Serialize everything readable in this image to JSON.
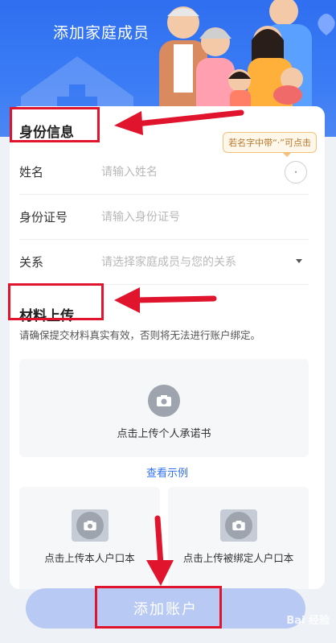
{
  "header": {
    "title": "添加家庭成员"
  },
  "identity": {
    "section_title": "身份信息",
    "tip": "若名字中带“·”可点击",
    "dot_button": "·",
    "fields": [
      {
        "label": "姓名",
        "placeholder": "请输入姓名"
      },
      {
        "label": "身份证号",
        "placeholder": "请输入身份证号"
      },
      {
        "label": "关系",
        "placeholder": "请选择家庭成员与您的关系"
      }
    ]
  },
  "materials": {
    "section_title": "材料上传",
    "note": "请确保提交材料真实有效，否则将无法进行账户绑定。",
    "upload_commitment": "点击上传个人承诺书",
    "view_example": "查看示例",
    "upload_own_hukou": "点击上传本人户口本",
    "upload_bound_hukou": "点击上传被绑定人户口本"
  },
  "submit_label": "添加账户",
  "watermark": "Bai 经验",
  "colors": {
    "primary": "#2f6ff0",
    "annotation": "#e0142c",
    "submit_bg": "#b8c9f3"
  }
}
